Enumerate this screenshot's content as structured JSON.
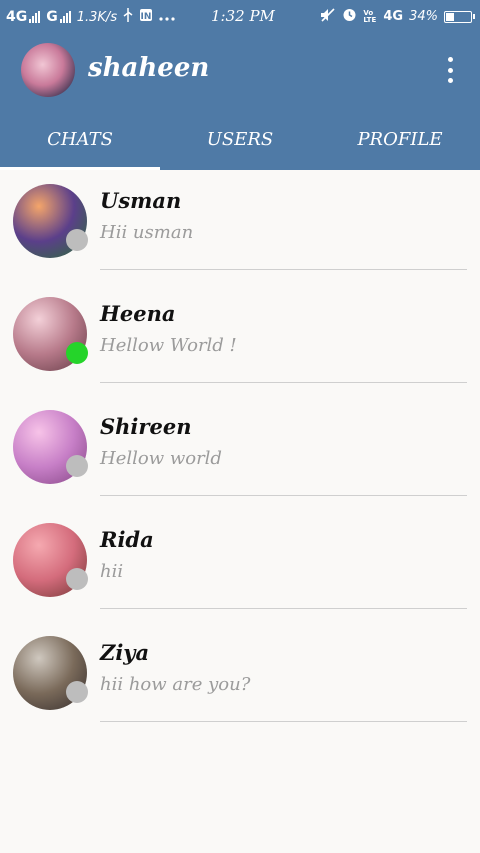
{
  "status_bar": {
    "sim1": "4G",
    "sim2": "G",
    "speed": "1.3K/s",
    "time": "1:32 PM",
    "network": "4G",
    "battery_text": "34%",
    "battery_level": 0.34,
    "volte": "Vo LTE"
  },
  "header": {
    "title": "shaheen",
    "avatar_icon": "profile-photo"
  },
  "tabs": [
    {
      "label": "CHATS",
      "active": true
    },
    {
      "label": "USERS",
      "active": false
    },
    {
      "label": "PROFILE",
      "active": false
    }
  ],
  "chats": [
    {
      "name": "Usman",
      "message": "Hii usman",
      "online": false,
      "avatar_colors": [
        "#f4a56a",
        "#5b3f8a",
        "#2e6b3c"
      ]
    },
    {
      "name": "Heena",
      "message": "Hellow World !",
      "online": true,
      "avatar_colors": [
        "#f3d0d8",
        "#b77a8a",
        "#6a3f4a"
      ]
    },
    {
      "name": "Shireen",
      "message": "Hellow world",
      "online": false,
      "avatar_colors": [
        "#f7c3e8",
        "#c77fc7",
        "#8a4a8a"
      ]
    },
    {
      "name": "Rida",
      "message": "hii",
      "online": false,
      "avatar_colors": [
        "#f5a9b0",
        "#d46c7c",
        "#7a3a3a"
      ]
    },
    {
      "name": "Ziya",
      "message": "hii how are you?",
      "online": false,
      "avatar_colors": [
        "#cfc8bf",
        "#7a6a5a",
        "#3a3230"
      ]
    }
  ],
  "colors": {
    "app_bar": "#4f7aa6",
    "online": "#25d42a",
    "offline": "#bdbdbd"
  }
}
